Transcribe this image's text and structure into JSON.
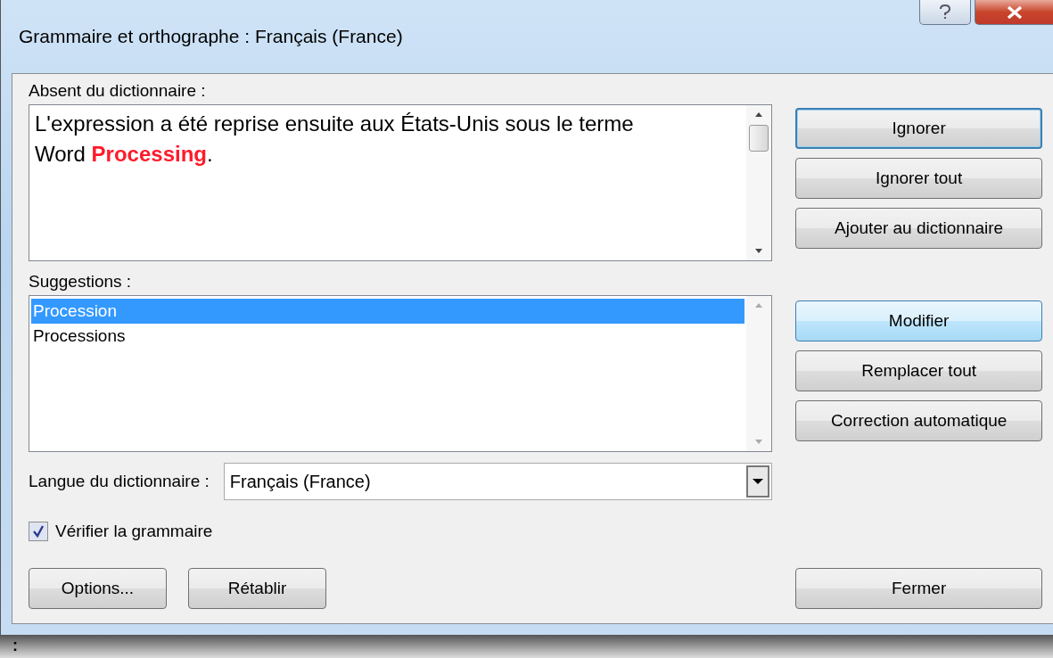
{
  "window": {
    "title": "Grammaire et orthographe : Français (France)"
  },
  "not_in_dictionary": {
    "label": "Absent du dictionnaire :",
    "text": "L'expression a été reprise ensuite aux États-Unis sous le terme Word **Processing**."
  },
  "suggestions": {
    "label": "Suggestions :",
    "items": [
      {
        "text": "Procession",
        "selected": true
      },
      {
        "text": "Processions",
        "selected": false
      }
    ]
  },
  "language": {
    "label": "Langue du dictionnaire :",
    "value": "Français (France)"
  },
  "check_grammar": {
    "label": "Vérifier la grammaire",
    "checked": true
  },
  "ignore_buttons": [
    {
      "label": "Ignorer",
      "focused": true,
      "default": false
    },
    {
      "label": "Ignorer tout",
      "focused": false,
      "default": false
    },
    {
      "label": "Ajouter au dictionnaire",
      "focused": false,
      "default": false
    }
  ],
  "change_buttons": [
    {
      "label": "Modifier",
      "focused": false,
      "default": true
    },
    {
      "label": "Remplacer tout",
      "focused": false,
      "default": false
    },
    {
      "label": "Correction automatique",
      "focused": false,
      "default": false
    }
  ],
  "bottom_buttons": [
    {
      "label": "Options..."
    },
    {
      "label": "Rétablir"
    }
  ],
  "close_button": {
    "label": "Fermer"
  },
  "background_text": ":"
}
